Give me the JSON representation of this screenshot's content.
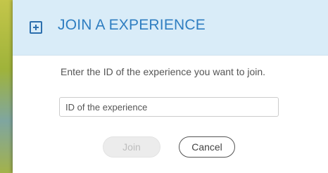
{
  "dialog": {
    "title": "JOIN A EXPERIENCE",
    "header_icon": "plus-square-icon",
    "instruction": "Enter the ID of the experience you want to join.",
    "input": {
      "value": "",
      "placeholder": "ID of the experience"
    },
    "buttons": {
      "join_label": "Join",
      "join_enabled": false,
      "cancel_label": "Cancel"
    }
  },
  "colors": {
    "header_bg": "#d9ecf8",
    "title": "#2f7ec1",
    "icon": "#2c6fae",
    "join_disabled_bg": "#ececec",
    "cancel_border": "#555555"
  }
}
